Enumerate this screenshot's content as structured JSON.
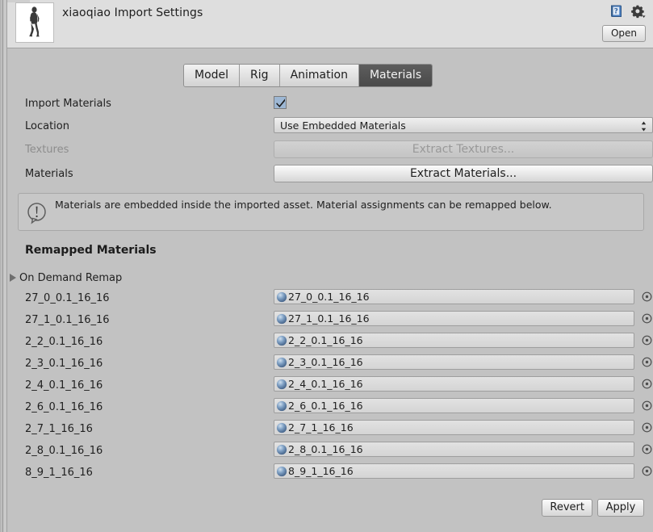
{
  "header": {
    "title": "xiaoqiao Import Settings",
    "thumbnail_icon": "humanoid-model-thumbnail",
    "help_icon": "help-book-icon",
    "settings_icon": "gear-dropdown-icon",
    "open_label": "Open"
  },
  "tabs": [
    {
      "label": "Model",
      "active": false
    },
    {
      "label": "Rig",
      "active": false
    },
    {
      "label": "Animation",
      "active": false
    },
    {
      "label": "Materials",
      "active": true
    }
  ],
  "properties": {
    "import_materials": {
      "label": "Import Materials",
      "checked": true
    },
    "location": {
      "label": "Location",
      "value": "Use Embedded Materials",
      "arrows_icon": "updown-arrows-icon"
    },
    "textures": {
      "label": "Textures",
      "button_label": "Extract Textures...",
      "disabled": true
    },
    "materials": {
      "label": "Materials",
      "button_label": "Extract Materials...",
      "disabled": false
    }
  },
  "infobox": {
    "icon": "info-exclamation-icon",
    "text": "Materials are embedded inside the imported asset. Material assignments can be remapped below."
  },
  "remapped": {
    "section_title": "Remapped Materials",
    "foldout_label": "On Demand Remap",
    "foldout_expanded": false,
    "rows": [
      {
        "name": "27_0_0.1_16_16",
        "value": "27_0_0.1_16_16"
      },
      {
        "name": "27_1_0.1_16_16",
        "value": "27_1_0.1_16_16"
      },
      {
        "name": "2_2_0.1_16_16",
        "value": "2_2_0.1_16_16"
      },
      {
        "name": "2_3_0.1_16_16",
        "value": "2_3_0.1_16_16"
      },
      {
        "name": "2_4_0.1_16_16",
        "value": "2_4_0.1_16_16"
      },
      {
        "name": "2_6_0.1_16_16",
        "value": "2_6_0.1_16_16"
      },
      {
        "name": "2_7_1_16_16",
        "value": "2_7_1_16_16"
      },
      {
        "name": "2_8_0.1_16_16",
        "value": "2_8_0.1_16_16"
      },
      {
        "name": "8_9_1_16_16",
        "value": "8_9_1_16_16"
      }
    ],
    "row_icon": "material-sphere-icon",
    "picker_icon": "object-picker-icon"
  },
  "footer": {
    "revert_label": "Revert",
    "apply_label": "Apply"
  },
  "colors": {
    "window_bg": "#c2c2c2",
    "header_bg": "#dedede",
    "active_tab_bg": "#4f4f4f",
    "checkbox_fill": "#9db7d4",
    "sphere_blue": "#6d8fb8"
  }
}
